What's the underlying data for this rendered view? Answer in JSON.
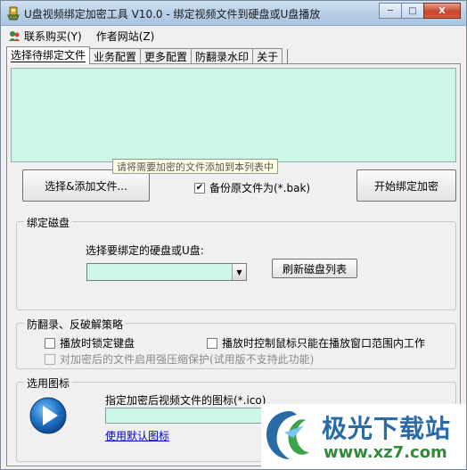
{
  "window": {
    "title": "U盘视频绑定加密工具 V10.0 - 绑定视频文件到硬盘或U盘播放",
    "minimize": "─",
    "maximize": "□",
    "close": "X"
  },
  "menu": {
    "items": [
      {
        "label": "联系购买(Y)",
        "icon": "contact-icon"
      },
      {
        "label": "作者网站(Z)"
      }
    ]
  },
  "tabs": [
    {
      "label": "选择待绑定文件",
      "active": true
    },
    {
      "label": "业务配置"
    },
    {
      "label": "更多配置"
    },
    {
      "label": "防翻录水印"
    },
    {
      "label": "关于"
    }
  ],
  "file_panel": {
    "tooltip": "请将需要加密的文件添加到本列表中",
    "add_button": "选择&添加文件...",
    "backup_label": "备份原文件为(*.bak)",
    "backup_checked": true,
    "start_button": "开始绑定加密"
  },
  "bind_disk": {
    "group_title": "绑定磁盘",
    "select_label": "选择要绑定的硬盘或U盘:",
    "selected_value": "",
    "refresh_button": "刷新磁盘列表"
  },
  "anti_record": {
    "group_title": "防翻录、反破解策略",
    "lock_keyboard": "播放时锁定键盘",
    "limit_mouse": "播放时控制鼠标只能在播放窗口范围内工作",
    "compress_protect": "对加密后的文件启用强压缩保护(试用版不支持此功能)"
  },
  "icon_section": {
    "group_title": "选用图标",
    "label": "指定加密后视频文件的图标(*.ico)",
    "path_value": "",
    "default_link": "使用默认图标"
  },
  "watermark": {
    "title": "极光下载站",
    "url": "www.xz7.com"
  },
  "colors": {
    "list_bg": "#ccf7e6",
    "play_icon": "#1e73c8",
    "link": "#0000cc"
  }
}
